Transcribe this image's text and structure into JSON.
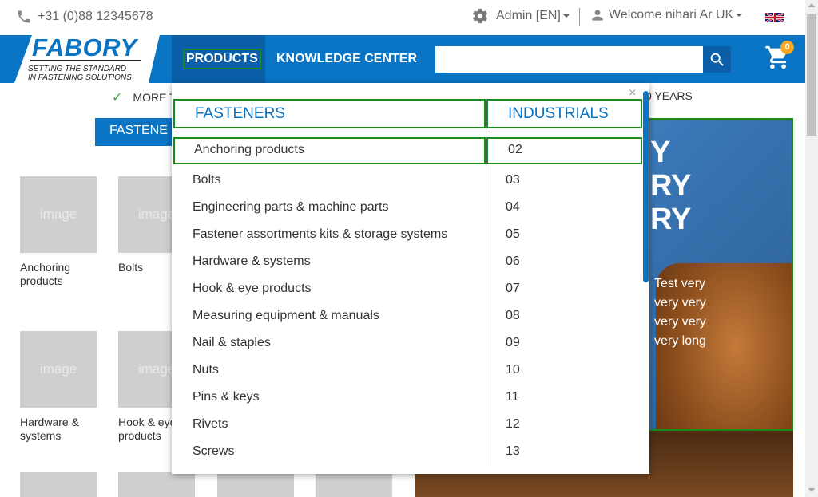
{
  "topbar": {
    "phone": "+31 (0)88 12345678",
    "admin": "Admin [EN]",
    "welcome": "Welcome nihari Ar UK"
  },
  "header": {
    "logo_name": "FABORY",
    "logo_tag_1": "SETTING THE STANDARD",
    "logo_tag_2": "IN FASTENING SOLUTIONS",
    "nav_products": "PRODUCTS",
    "nav_knowledge": "KNOWLEDGE CENTER",
    "search_value": "",
    "cart_count": "0"
  },
  "page": {
    "usp_left": "MORE T",
    "usp_right": "0 YEARS",
    "fasteners_tab": "FASTENE",
    "tiles": [
      {
        "placeholder": "image",
        "label": "Anchoring products"
      },
      {
        "placeholder": "image",
        "label": "Bolts"
      },
      {
        "placeholder": "image",
        "label": "Hardware & systems"
      },
      {
        "placeholder": "image",
        "label": "Hook & eye products"
      },
      {
        "placeholder": "",
        "label": ""
      },
      {
        "placeholder": "",
        "label": ""
      },
      {
        "placeholder": "",
        "label": ""
      },
      {
        "placeholder": "",
        "label": ""
      }
    ],
    "banner": {
      "big": [
        "Y",
        "RY",
        "RY"
      ],
      "small": [
        "Test very",
        "very very",
        "very very",
        "very long"
      ]
    }
  },
  "dropdown": {
    "close": "×",
    "col_left_title": "FASTENERS",
    "col_right_title": "INDUSTRIALS",
    "left_items": [
      "Anchoring products",
      "Bolts",
      "Engineering parts & machine parts",
      "Fastener assortments kits & storage systems",
      "Hardware & systems",
      "Hook & eye products",
      "Measuring equipment & manuals",
      "Nail & staples",
      "Nuts",
      "Pins & keys",
      "Rivets",
      "Screws"
    ],
    "right_items": [
      "02",
      "03",
      "04",
      "05",
      "06",
      "07",
      "08",
      "09",
      "10",
      "11",
      "12",
      "13"
    ]
  },
  "colors": {
    "brand_blue": "#0a74c4",
    "nav_dark_blue": "#0a5fa8",
    "focus_green": "#1a8a1a",
    "badge_orange": "#f5a623"
  },
  "icons": {
    "phone": "phone-icon",
    "gear": "gear-icon",
    "user": "user-icon",
    "flag": "uk-flag-icon",
    "search": "search-icon",
    "cart": "cart-icon",
    "check": "check-icon"
  }
}
